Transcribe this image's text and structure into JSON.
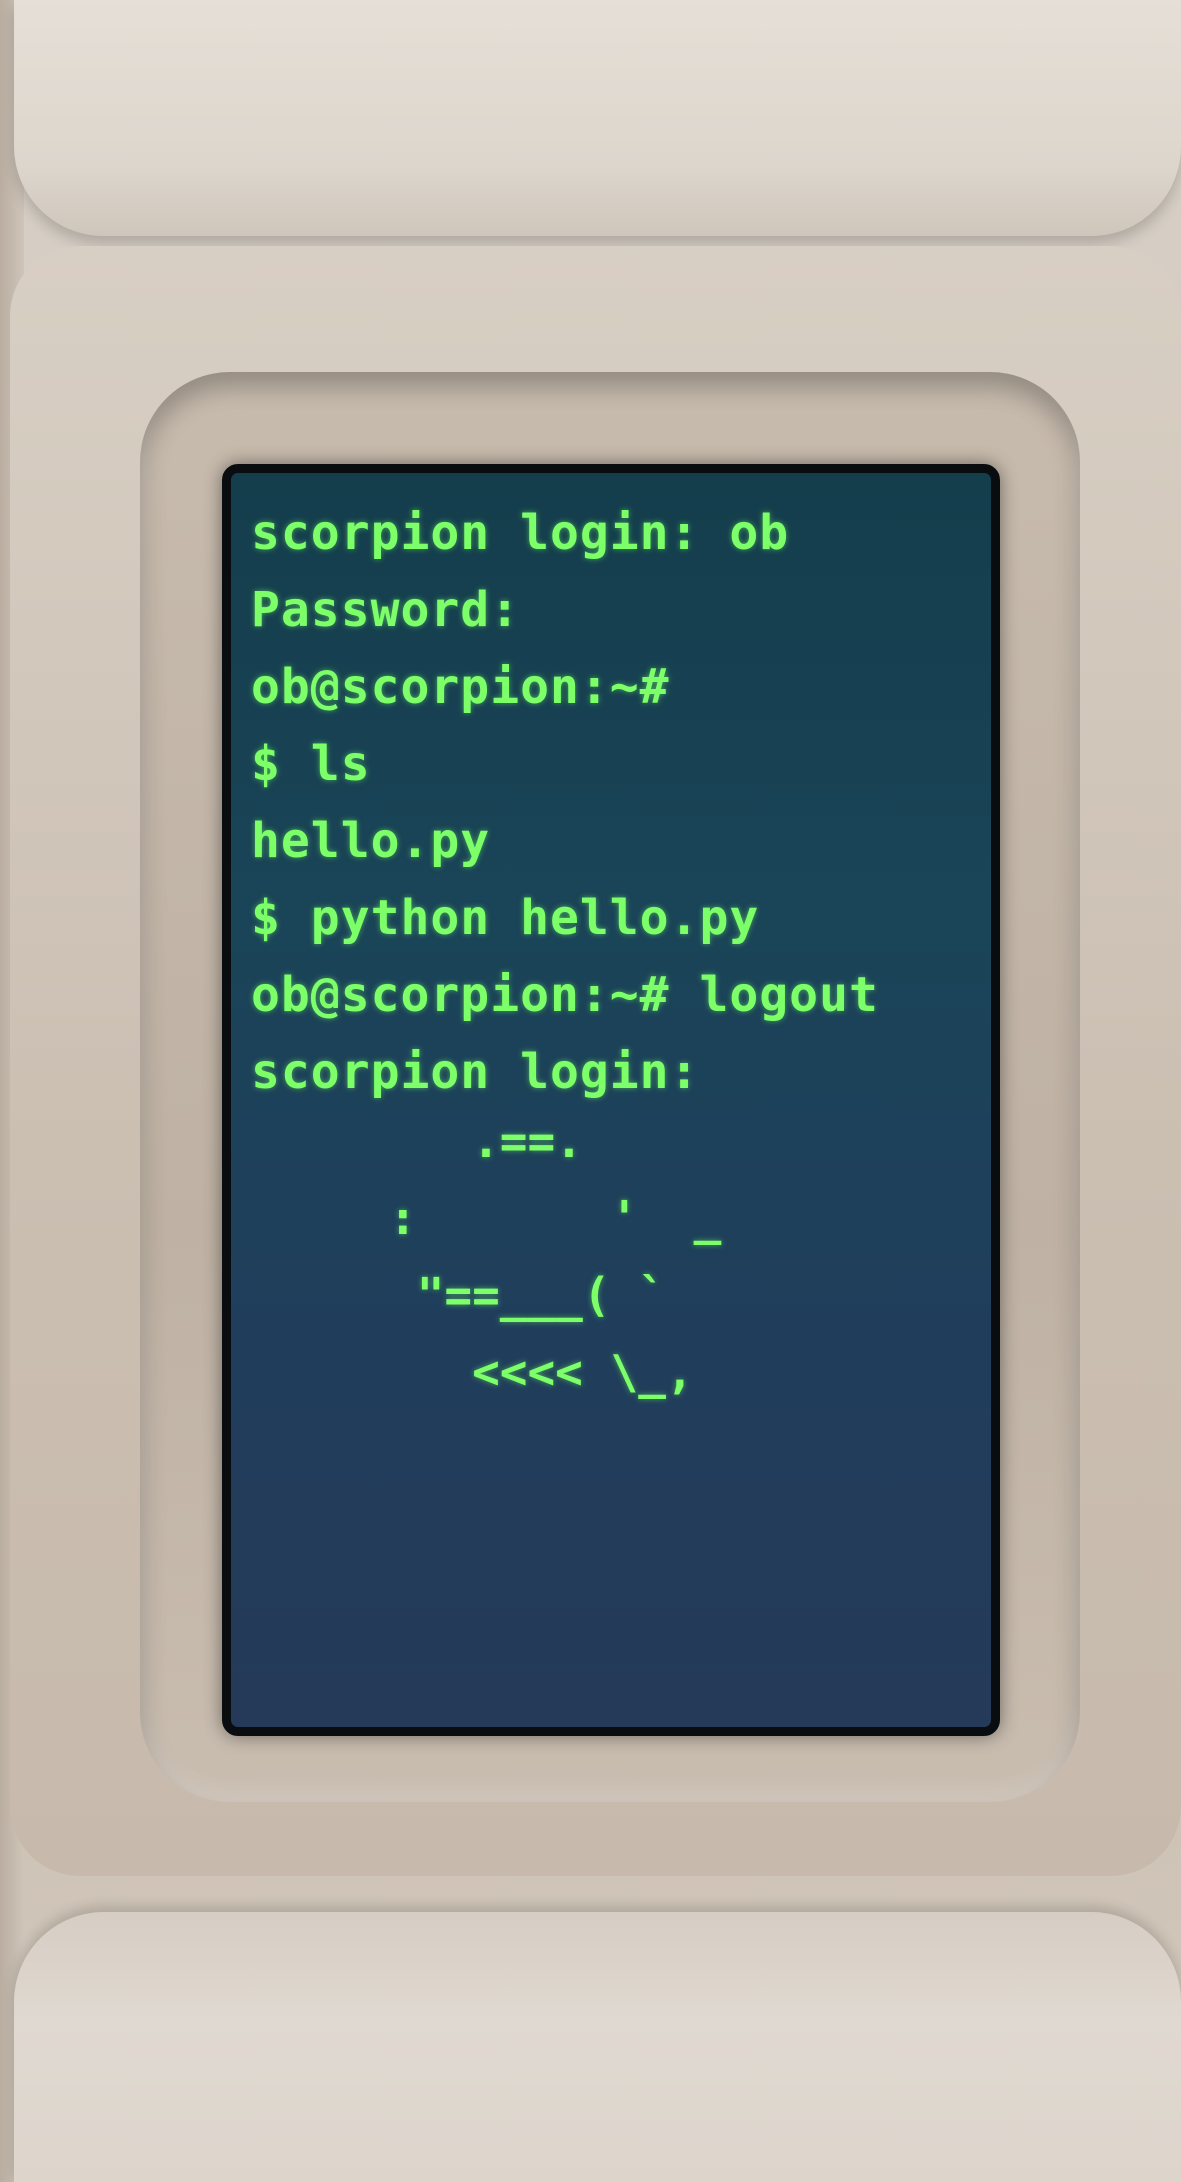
{
  "screen": {
    "colors": {
      "text": "#7dff6a",
      "background": "#1d4258",
      "device_body": "#d8cfc4"
    },
    "terminal_lines": [
      "scorpion login: ob",
      "Password:",
      "ob@scorpion:~#",
      "$ ls",
      "hello.py",
      "$ python hello.py",
      "ob@scorpion:~# logout",
      "scorpion login:"
    ],
    "ascii_art": "   .==.\n:       '  _\n \"==___( `\n   <<<< \\_,"
  }
}
